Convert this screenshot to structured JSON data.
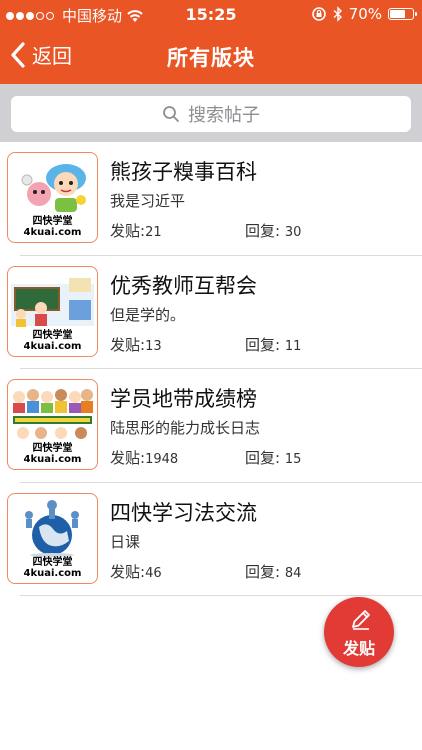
{
  "status_bar": {
    "carrier": "中国移动",
    "time": "15:25",
    "battery": "70%",
    "battery_level": 0.7
  },
  "nav": {
    "back_label": "返回",
    "title": "所有版块"
  },
  "search": {
    "placeholder": "搜索帖子"
  },
  "labels": {
    "posts": "发贴:",
    "replies": "回复:"
  },
  "brand": {
    "line1": "四快学堂",
    "line2": "4kuai.com"
  },
  "boards": [
    {
      "title": "熊孩子糗事百科",
      "subtitle": "我是习近平",
      "posts": "21",
      "replies": "30",
      "thumb_icon": "cartoon-kids-icon"
    },
    {
      "title": "优秀教师互帮会",
      "subtitle": "但是学的。",
      "posts": "13",
      "replies": "11",
      "thumb_icon": "teacher-classroom-icon"
    },
    {
      "title": "学员地带成绩榜",
      "subtitle": "陆思彤的能力成长日志",
      "posts": "1948",
      "replies": "15",
      "thumb_icon": "back-to-school-icon"
    },
    {
      "title": "四快学习法交流",
      "subtitle": "日课",
      "posts": "46",
      "replies": "84",
      "thumb_icon": "globe-people-icon"
    }
  ],
  "fab": {
    "label": "发贴",
    "icon": "pencil-icon"
  },
  "colors": {
    "accent": "#ea5525",
    "fab": "#e23b36",
    "search_bg": "#cfcfd4"
  }
}
